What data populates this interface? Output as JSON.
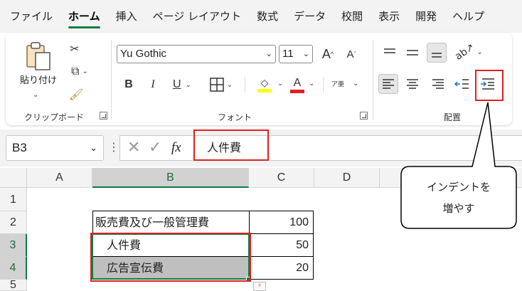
{
  "ribbon_tabs": [
    "ファイル",
    "ホーム",
    "挿入",
    "ページ レイアウト",
    "数式",
    "データ",
    "校閲",
    "表示",
    "開発",
    "ヘルプ"
  ],
  "clipboard": {
    "paste_label": "貼り付け",
    "group_label": "クリップボード"
  },
  "font": {
    "name": "Yu Gothic",
    "size": "11",
    "group_label": "フォント",
    "bold": "B",
    "italic": "I",
    "underline": "U",
    "grow": "A",
    "shrink": "A",
    "font_color_letter": "A",
    "phonetic": "ア亜"
  },
  "alignment": {
    "group_label": "配置"
  },
  "colors": {
    "accent": "#107c41",
    "highlight_yellow": "#ffff00",
    "font_red": "#e02020",
    "annotation_red": "#e02020",
    "selected_fill": "#bfbfbf"
  },
  "formula_bar": {
    "name_box": "B3",
    "fx": "fx",
    "content": "人件費"
  },
  "columns": [
    "A",
    "B",
    "C",
    "D"
  ],
  "rows": [
    "1",
    "2",
    "3",
    "4",
    "5"
  ],
  "table": [
    {
      "label": "販売費及び一般管理費",
      "value": "100"
    },
    {
      "label": "人件費",
      "value": "50"
    },
    {
      "label": "広告宣伝費",
      "value": "20"
    }
  ],
  "callout": {
    "line1": "インデントを",
    "line2": "増やす"
  }
}
